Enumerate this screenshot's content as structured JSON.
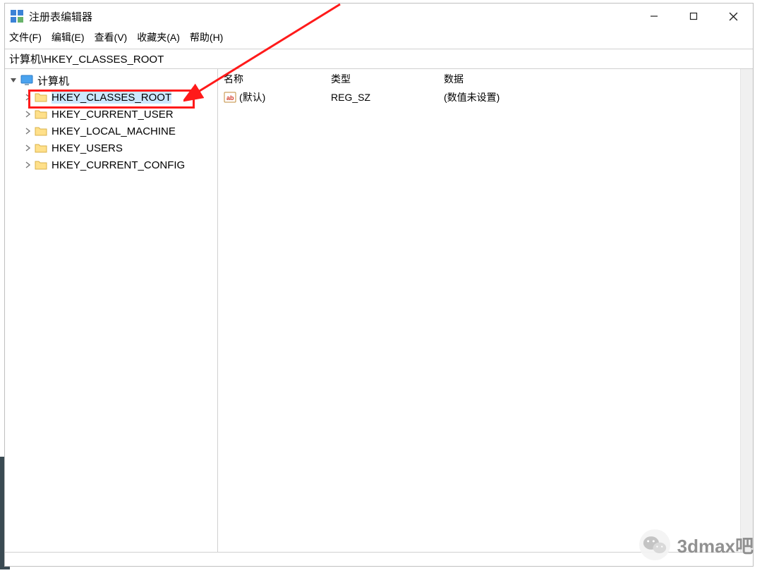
{
  "window": {
    "title": "注册表编辑器"
  },
  "menus": {
    "file": "文件(F)",
    "edit": "编辑(E)",
    "view": "查看(V)",
    "fav": "收藏夹(A)",
    "help": "帮助(H)"
  },
  "address": "计算机\\HKEY_CLASSES_ROOT",
  "tree": {
    "root": "计算机",
    "items": [
      {
        "label": "HKEY_CLASSES_ROOT",
        "selected": true
      },
      {
        "label": "HKEY_CURRENT_USER",
        "selected": false
      },
      {
        "label": "HKEY_LOCAL_MACHINE",
        "selected": false
      },
      {
        "label": "HKEY_USERS",
        "selected": false
      },
      {
        "label": "HKEY_CURRENT_CONFIG",
        "selected": false
      }
    ]
  },
  "listHeaders": {
    "name": "名称",
    "type": "类型",
    "data": "数据"
  },
  "listRows": [
    {
      "name": "(默认)",
      "type": "REG_SZ",
      "data": "(数值未设置)"
    }
  ],
  "watermark": "3dmax吧"
}
